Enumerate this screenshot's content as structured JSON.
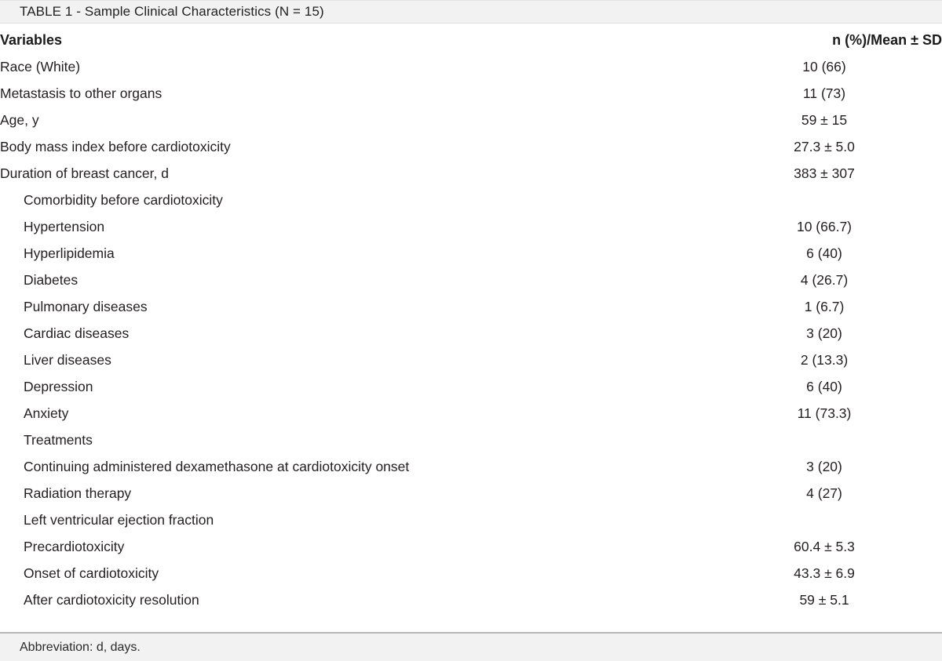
{
  "table": {
    "caption": "TABLE 1 - Sample Clinical Characteristics (N = 15)",
    "columns": {
      "label": "Variables",
      "value": "n (%)/Mean ± SD"
    },
    "footnote": "Abbreviation: d, days.",
    "rows": [
      {
        "label": "Race (White)",
        "value": "10 (66)",
        "indent": 2
      },
      {
        "label": "Metastasis to other organs",
        "value": "11 (73)",
        "indent": 2
      },
      {
        "label": "Age, y",
        "value": "59 ± 15",
        "indent": 2
      },
      {
        "label": "Body mass index before cardiotoxicity",
        "value": "27.3 ± 5.0",
        "indent": 2
      },
      {
        "label": "Duration of breast cancer, d",
        "value": "383 ± 307",
        "indent": 2
      },
      {
        "label": "Comorbidity before cardiotoxicity",
        "value": "",
        "indent": 1
      },
      {
        "label": "Hypertension",
        "value": "10 (66.7)",
        "indent": 1
      },
      {
        "label": "Hyperlipidemia",
        "value": "6 (40)",
        "indent": 1
      },
      {
        "label": "Diabetes",
        "value": "4 (26.7)",
        "indent": 1
      },
      {
        "label": "Pulmonary diseases",
        "value": "1 (6.7)",
        "indent": 1
      },
      {
        "label": "Cardiac diseases",
        "value": "3 (20)",
        "indent": 1
      },
      {
        "label": "Liver diseases",
        "value": "2 (13.3)",
        "indent": 1
      },
      {
        "label": "Depression",
        "value": "6 (40)",
        "indent": 1
      },
      {
        "label": "Anxiety",
        "value": "11 (73.3)",
        "indent": 1
      },
      {
        "label": "Treatments",
        "value": "",
        "indent": 1
      },
      {
        "label": "Continuing administered dexamethasone at cardiotoxicity onset",
        "value": "3 (20)",
        "indent": 1
      },
      {
        "label": "Radiation therapy",
        "value": "4 (27)",
        "indent": 1
      },
      {
        "label": "Left ventricular ejection fraction",
        "value": "",
        "indent": 1
      },
      {
        "label": "Precardiotoxicity",
        "value": "60.4 ± 5.3",
        "indent": 1
      },
      {
        "label": "Onset of cardiotoxicity",
        "value": "43.3 ± 6.9",
        "indent": 1
      },
      {
        "label": "After cardiotoxicity resolution",
        "value": "59 ± 5.1",
        "indent": 1
      }
    ]
  }
}
